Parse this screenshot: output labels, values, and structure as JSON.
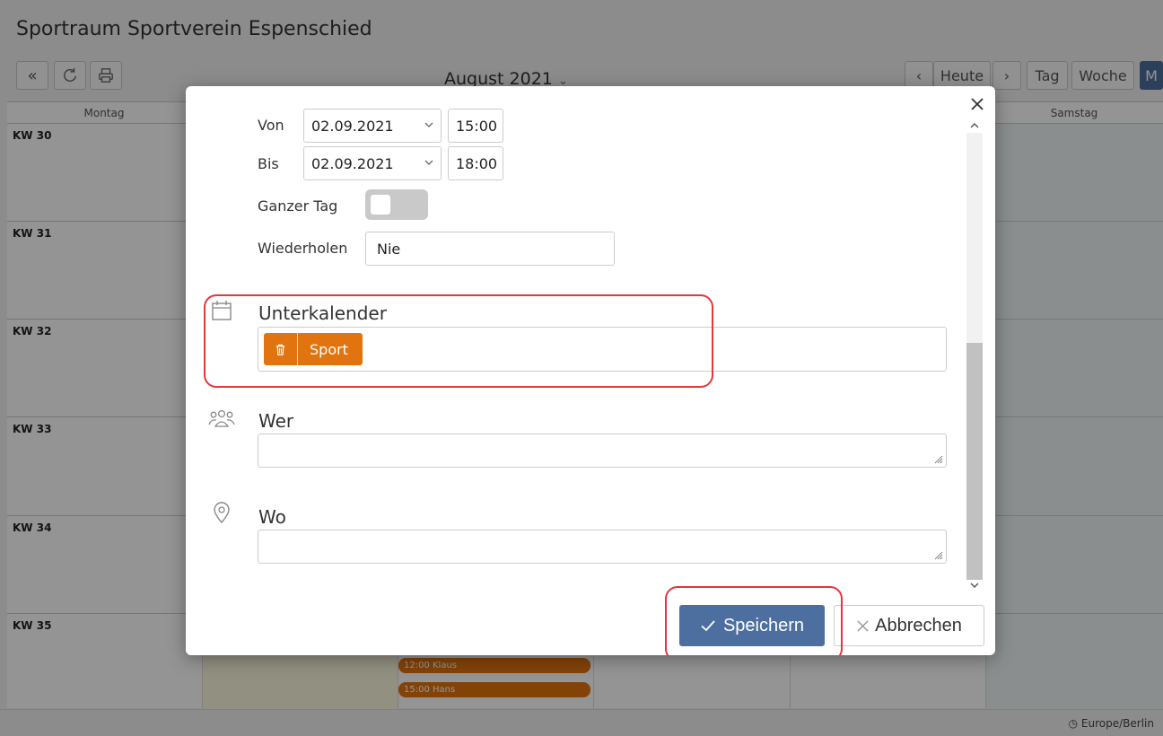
{
  "app": {
    "title": "Sportraum Sportverein Espenschied"
  },
  "toolbar": {
    "month_label": "August 2021",
    "today_label": "Heute",
    "day_label": "Tag",
    "week_label": "Woche",
    "month_btn_label": "M"
  },
  "calendar": {
    "day_headers": [
      "Montag",
      "Samstag"
    ],
    "weeks": [
      "KW 30",
      "KW 31",
      "KW 32",
      "KW 33",
      "KW 34",
      "KW 35"
    ],
    "events": [
      "12:00 Klaus",
      "15:00 Hans"
    ]
  },
  "footer": {
    "timezone": "Europe/Berlin"
  },
  "modal": {
    "from_label": "Von",
    "from_date": "02.09.2021",
    "from_time": "15:00",
    "to_label": "Bis",
    "to_date": "02.09.2021",
    "to_time": "18:00",
    "all_day_label": "Ganzer Tag",
    "all_day_on": false,
    "repeat_label": "Wiederholen",
    "repeat_value": "Nie",
    "subcalendar_title": "Unterkalender",
    "subcalendar_tag": "Sport",
    "who_title": "Wer",
    "where_title": "Wo",
    "save_label": "Speichern",
    "cancel_label": "Abbrechen"
  },
  "colors": {
    "accent": "#4d6f9f",
    "tag_orange": "#e2740f",
    "highlight_red": "#e0383d"
  }
}
